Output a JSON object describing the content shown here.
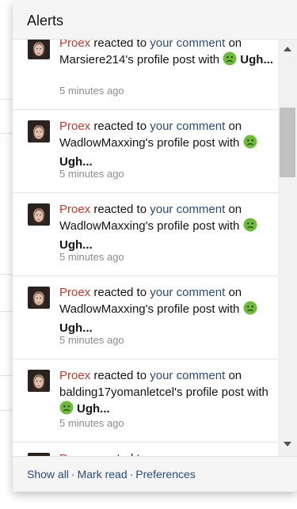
{
  "menu": {
    "title": "Alerts"
  },
  "alerts": [
    {
      "user": "Proex",
      "action": "reacted to",
      "link": "your comment",
      "on": "on",
      "target": "Marsiere214's profile post with",
      "reaction": "Ugh...",
      "time": "5 minutes ago"
    },
    {
      "user": "Proex",
      "action": "reacted to",
      "link": "your comment",
      "on": "on",
      "target": "WadlowMaxxing's profile post with",
      "reaction": "Ugh...",
      "time": "5 minutes ago"
    },
    {
      "user": "Proex",
      "action": "reacted to",
      "link": "your comment",
      "on": "on",
      "target": "WadlowMaxxing's profile post with",
      "reaction": "Ugh...",
      "time": "5 minutes ago"
    },
    {
      "user": "Proex",
      "action": "reacted to",
      "link": "your comment",
      "on": "on",
      "target": "WadlowMaxxing's profile post with",
      "reaction": "Ugh...",
      "time": "5 minutes ago"
    },
    {
      "user": "Proex",
      "action": "reacted to",
      "link": "your comment",
      "on": "on",
      "target": "balding17yomanletcel's profile post with",
      "reaction": "Ugh...",
      "time": "5 minutes ago"
    },
    {
      "user": "Proex",
      "action": "reacted to",
      "link": "",
      "on": "",
      "target": "",
      "reaction": "",
      "time": ""
    }
  ],
  "footer": {
    "show_all": "Show all",
    "mark_read": "Mark read",
    "preferences": "Preferences",
    "separator": "·"
  },
  "icons": {
    "reaction": "sick-face-emoji-icon",
    "avatar": "user-avatar"
  },
  "colors": {
    "user_link": "#c0392b",
    "content_link": "#2c4a7a",
    "header_bg": "#f5f5f5",
    "emoji": "#6dbb3c"
  }
}
